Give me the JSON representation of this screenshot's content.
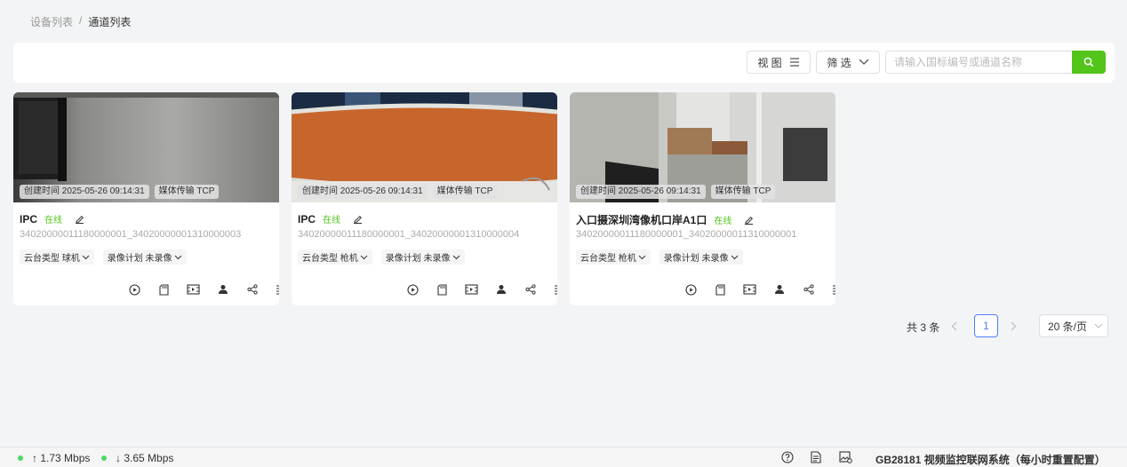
{
  "breadcrumb": {
    "parent": "设备列表",
    "separator": "/",
    "current": "通道列表"
  },
  "toolbar": {
    "view_label": "视 图",
    "filter_label": "筛 选",
    "search_placeholder": "请输入国标编号或通道名称"
  },
  "cards": [
    {
      "created_tag": "创建时间 2025-05-26 09:14:31",
      "media_tag": "媒体传输 TCP",
      "name": "IPC",
      "status": "在线",
      "channel_id": "34020000011180000001_34020000001310000003",
      "ptz_label": "云台类型 球机",
      "record_label": "录像计划 未录像"
    },
    {
      "created_tag": "创建时间 2025-05-26 09:14:31",
      "media_tag": "媒体传输 TCP",
      "name": "IPC",
      "status": "在线",
      "channel_id": "34020000011180000001_34020000001310000004",
      "ptz_label": "云台类型 枪机",
      "record_label": "录像计划 未录像"
    },
    {
      "created_tag": "创建时间 2025-05-26 09:14:31",
      "media_tag": "媒体传输 TCP",
      "name": "入口摄深圳湾像机口岸A1口",
      "status": "在线",
      "channel_id": "34020000011180000001_34020000011310000001",
      "ptz_label": "云台类型 枪机",
      "record_label": "录像计划 未录像"
    }
  ],
  "card_action_icons": [
    "play-icon",
    "sd-card-icon",
    "video-record-icon",
    "user-icon",
    "share-icon",
    "details-icon"
  ],
  "pagination": {
    "total": "共 3 条",
    "current_page": "1",
    "page_size": "20 条/页"
  },
  "statusbar": {
    "upload": "↑ 1.73 Mbps",
    "download": "↓ 3.65 Mbps",
    "system_title": "GB28181 视频监控联网系统（每小时重置配置）"
  },
  "colors": {
    "accent_green": "#52c41a",
    "online": "#52c41a",
    "page_active": "#4d7cf5"
  }
}
